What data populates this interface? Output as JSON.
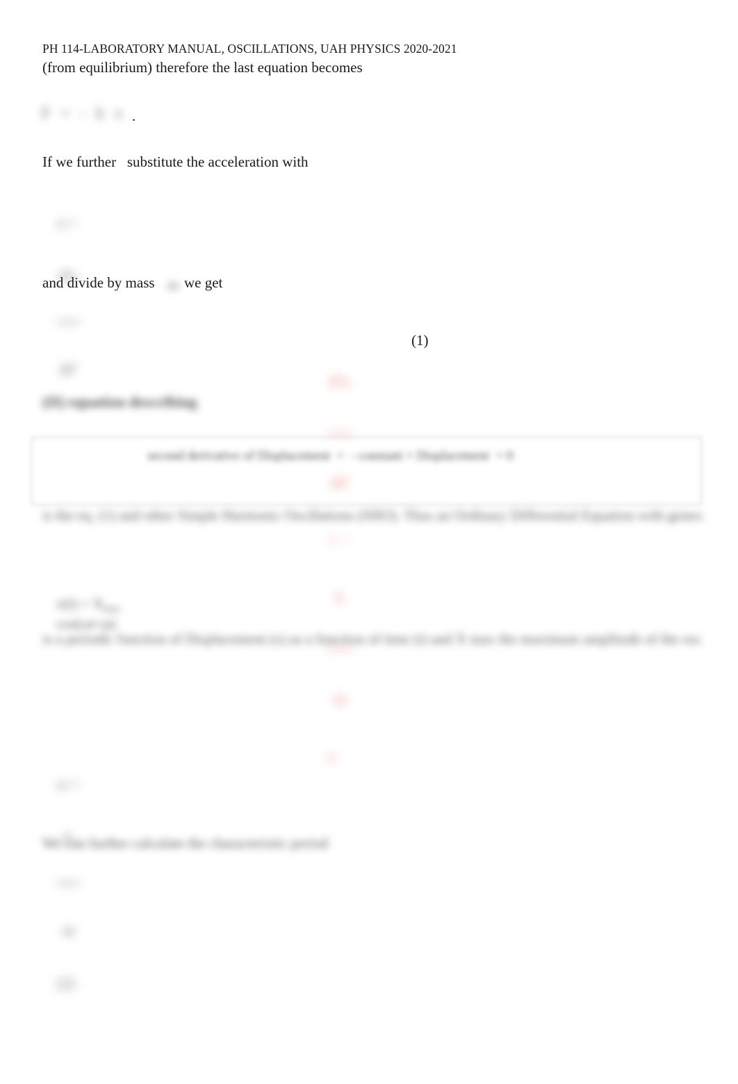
{
  "document": {
    "header": "PH 114-LABORATORY MANUAL, OSCILLATIONS, UAH PHYSICS 2020-2021",
    "line_becomes": "(from equilibrium) therefore the last equation becomes",
    "equation_force": "F = - k x",
    "period_after_equation": ".",
    "line_substitute": "If we further   substitute the acceleration with",
    "equation_acceleration_lhs": "a =",
    "equation_acceleration_num": "d²x",
    "equation_acceleration_den": "dt²",
    "line_divide_before": "and divide by mass",
    "mass_symbol": "m",
    "line_divide_after": "we get",
    "equation_one_num1": "d²x",
    "equation_one_den1": "dt²",
    "equation_one_op": "= −",
    "equation_one_num2": "k",
    "equation_one_den2": "m",
    "equation_one_tail": "x",
    "equation_number": "(1)",
    "heading": "(II) equation describing",
    "boxed_statement": "second derivative of Displacement  =  - constant × Displacement  = 0",
    "paragraph_shm": "is the eq. (1) and other Simple Harmonic Oscillations (SHO). Thus an Ordinary Differential Equation with general solution",
    "equation_xt": "x(t) = X",
    "equation_xt_sub": "max",
    "equation_xt_tail": "cos(ωt+φ)",
    "paragraph_periodic": "is a periodic function of Displacement (x) as a function of time (t) and X max the maximum amplitude of the oscillation. What describes the actual physical process, i.e. vertical springs, is the so-called characteristic angular frequency (ω). This is a part of the solution and such and for the spring is defined as",
    "equation_omega_lhs": "ω =",
    "equation_omega_num": "k",
    "equation_omega_den": "m",
    "equation_omega_tail": "(2)",
    "line_period": "We can further calculate the characteristic period"
  }
}
